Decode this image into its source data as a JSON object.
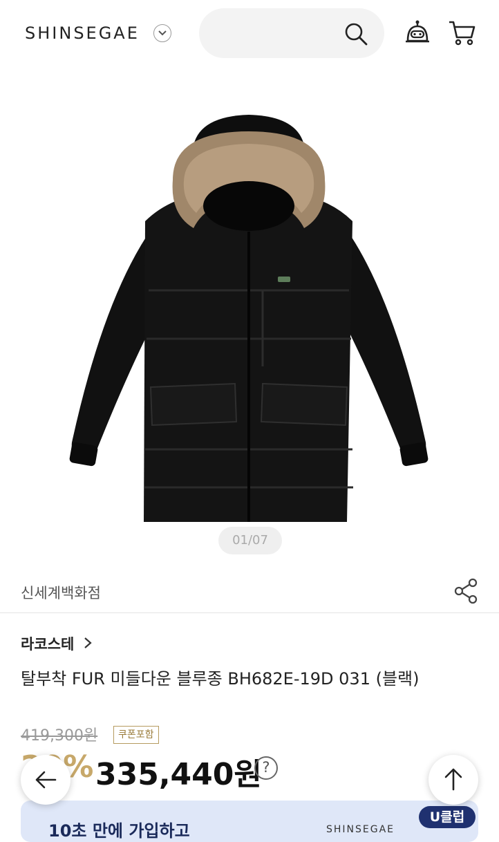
{
  "header": {
    "logo": "SHINSEGAE",
    "search_placeholder": ""
  },
  "gallery": {
    "pager": "01/07"
  },
  "store": {
    "name": "신세계백화점"
  },
  "product": {
    "brand": "라코스테",
    "title": "탈부착 FUR 미들다운 블루종 BH682E-19D 031 (블랙)",
    "original_price": "419,300원",
    "coupon_badge": "쿠폰포함",
    "discount": "20%",
    "sale_price": "335,440원",
    "help": "?"
  },
  "banner": {
    "text": "10초 만에 가입하고",
    "logo": "SHINSEGAE",
    "badge": "U클럽"
  },
  "icons": {
    "search": "search-icon",
    "bot": "chatbot-icon",
    "cart": "cart-icon",
    "share": "share-icon",
    "back": "arrow-left-icon",
    "top": "arrow-up-icon"
  }
}
